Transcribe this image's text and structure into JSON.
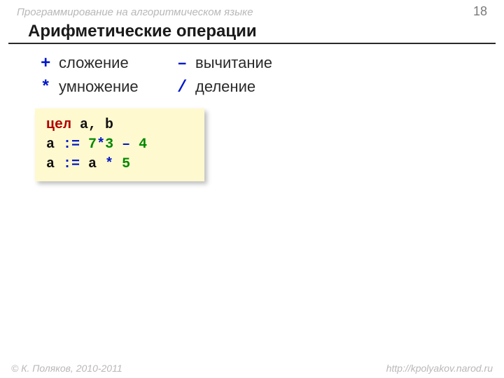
{
  "header": {
    "subject": "Программирование на алгоритмическом языке",
    "page": "18"
  },
  "title": "Арифметические операции",
  "ops": {
    "row1": {
      "sym1": "+",
      "label1": "сложение",
      "sym2": "–",
      "label2": "вычитание"
    },
    "row2": {
      "sym1": "*",
      "label1": "умножение",
      "sym2": "/",
      "label2": "деление"
    }
  },
  "code": {
    "l1_kw": "цел",
    "l1_rest": " a, b",
    "l2_a": "a ",
    "l2_assign": ":=",
    "l2_sp1": " ",
    "l2_n1": "7",
    "l2_op1": "*",
    "l2_n2": "3",
    "l2_sp2": " ",
    "l2_op2": "–",
    "l2_sp3": " ",
    "l2_n3": "4",
    "l3_a": "a ",
    "l3_assign": ":=",
    "l3_mid": " a ",
    "l3_op": "*",
    "l3_sp": " ",
    "l3_n": "5"
  },
  "footer": {
    "copyright": "© К. Поляков, 2010-2011",
    "url": "http://kpolyakov.narod.ru"
  }
}
